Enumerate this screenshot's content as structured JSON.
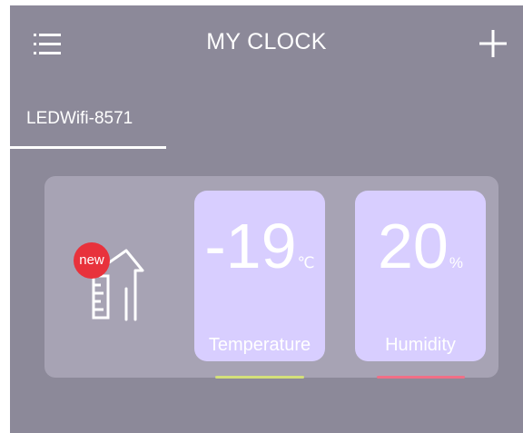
{
  "app": {
    "title": "MY CLOCK",
    "menu_icon": "list-menu-icon",
    "add_icon": "plus-icon"
  },
  "tabs": [
    {
      "label": "LEDWifi-8571",
      "selected": true
    }
  ],
  "device": {
    "icon": "house-thermometer-icon",
    "badge": "new",
    "temperature": {
      "value": "-19",
      "unit": "℃",
      "label": "Temperature",
      "accent": "#d4e07a"
    },
    "humidity": {
      "value": "20",
      "unit": "%",
      "label": "Humidity",
      "accent": "#f06f86"
    }
  },
  "colors": {
    "background": "#8c8999",
    "card": "#a7a3b4",
    "tile": "#d8ceff",
    "badge": "#e8323c"
  }
}
